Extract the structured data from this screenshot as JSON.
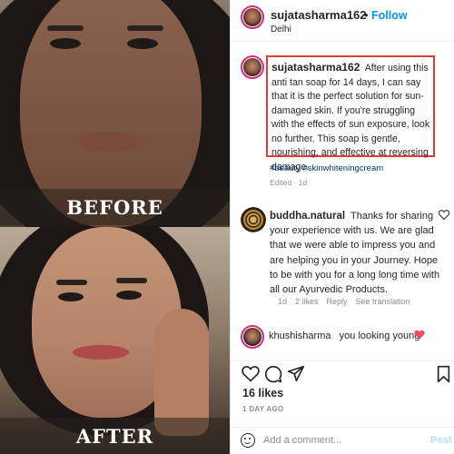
{
  "media": {
    "before_label": "BEFORE",
    "after_label": "AFTER"
  },
  "header": {
    "username": "sujatasharma162",
    "separator": "•",
    "follow_label": "Follow",
    "location": "Delhi",
    "more_icon": "more-horizontal-icon"
  },
  "caption": {
    "username": "sujatasharma162",
    "text": "After using this anti tan soap for 14 days, I can say that it is the perfect solution for sun-damaged skin. If you're struggling with the effects of sun exposure, look no further. This soap is gentle, nourishing, and effective at reversing damage.",
    "hashtags": "#beauty #skinwhiteningcream",
    "edited": "Edited · 1d"
  },
  "comments": [
    {
      "username": "buddha.natural",
      "text": "Thanks for sharing your experience with us. We are glad that we were able to impress you and are helping you in your Journey. Hope to be with you for a long long time with all our Ayurvedic Products.",
      "time": "1d",
      "likes": "2 likes",
      "reply": "Reply",
      "translate": "See translation"
    },
    {
      "username": "khushisharma",
      "text": "you looking young"
    }
  ],
  "actions": {
    "like_icon": "heart-outline-icon",
    "comment_icon": "comment-icon",
    "share_icon": "send-icon",
    "save_icon": "bookmark-icon"
  },
  "post_stats": {
    "likes": "16 likes",
    "time_ago": "1 DAY AGO"
  },
  "add_comment": {
    "placeholder": "Add a comment...",
    "post_label": "Post"
  },
  "colors": {
    "follow_blue": "#0095f6",
    "highlight_red": "#e53a3a",
    "heart_red": "#ed4956",
    "hashtag_blue": "#00376b",
    "muted_gray": "#8e8e8e"
  }
}
